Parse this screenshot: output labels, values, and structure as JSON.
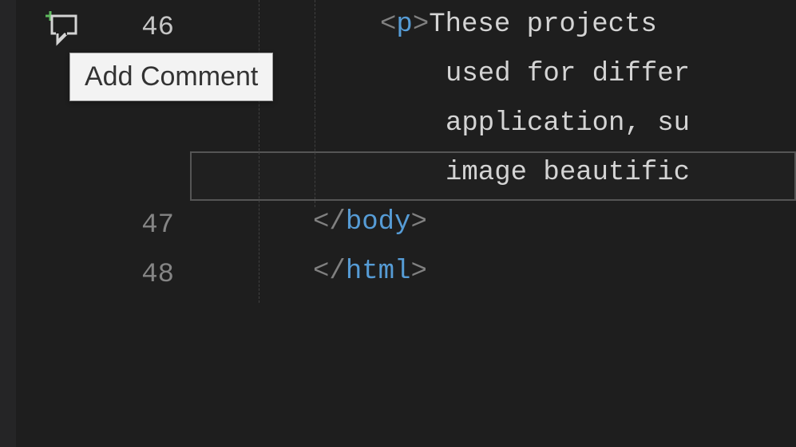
{
  "tooltip": {
    "add_comment": "Add Comment"
  },
  "lines": {
    "n46": "46",
    "n47": "47",
    "n48": "48"
  },
  "code": {
    "line46_tag_open": "<",
    "line46_tag_name": "p",
    "line46_tag_close": ">",
    "line46_text": "These projects",
    "line46_wrap1": "used for differ",
    "line46_wrap2": "application, su",
    "line46_wrap3": "image beautific",
    "line47_open": "</",
    "line47_name": "body",
    "line47_close": ">",
    "line48_open": "</",
    "line48_name": "html",
    "line48_close": ">"
  }
}
